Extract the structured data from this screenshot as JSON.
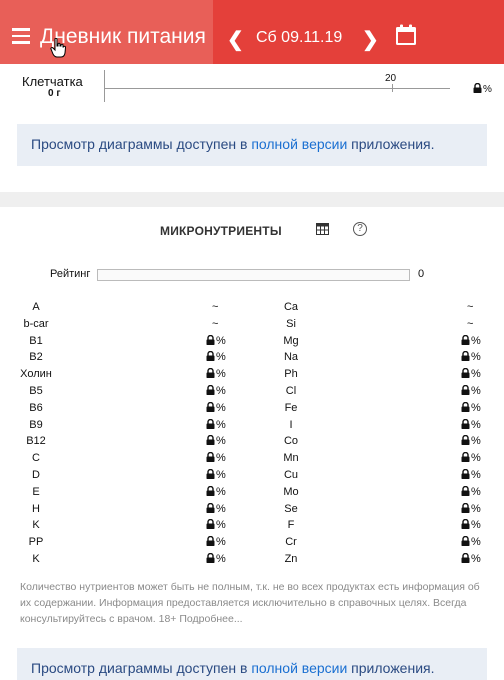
{
  "header": {
    "app_title": "Дневник питания",
    "prev_label": "❮",
    "date": "Сб 09.11.19",
    "next_label": "❯"
  },
  "fiber": {
    "label": "Клетчатка",
    "value": "0 г",
    "tick": "20",
    "pct": "%"
  },
  "notice": {
    "prefix": "Просмотр диаграммы доступен в ",
    "link": "полной версии",
    "suffix": " приложения."
  },
  "micro": {
    "title": "МИКРОНУТРИЕНТЫ",
    "help": "?",
    "rating_label": "Рейтинг",
    "rating_value": "0",
    "left": [
      {
        "name": "A",
        "value": "~"
      },
      {
        "name": "b-car",
        "value": "~"
      },
      {
        "name": "B1",
        "value": "%"
      },
      {
        "name": "B2",
        "value": "%"
      },
      {
        "name": "Холин",
        "value": "%"
      },
      {
        "name": "B5",
        "value": "%"
      },
      {
        "name": "B6",
        "value": "%"
      },
      {
        "name": "B9",
        "value": "%"
      },
      {
        "name": "B12",
        "value": "%"
      },
      {
        "name": "C",
        "value": "%"
      },
      {
        "name": "D",
        "value": "%"
      },
      {
        "name": "E",
        "value": "%"
      },
      {
        "name": "H",
        "value": "%"
      },
      {
        "name": "K",
        "value": "%"
      },
      {
        "name": "PP",
        "value": "%"
      },
      {
        "name": "K",
        "value": "%"
      }
    ],
    "right": [
      {
        "name": "Ca",
        "value": "~"
      },
      {
        "name": "Si",
        "value": "~"
      },
      {
        "name": "Mg",
        "value": "%"
      },
      {
        "name": "Na",
        "value": "%"
      },
      {
        "name": "Ph",
        "value": "%"
      },
      {
        "name": "Cl",
        "value": "%"
      },
      {
        "name": "Fe",
        "value": "%"
      },
      {
        "name": "I",
        "value": "%"
      },
      {
        "name": "Co",
        "value": "%"
      },
      {
        "name": "Mn",
        "value": "%"
      },
      {
        "name": "Cu",
        "value": "%"
      },
      {
        "name": "Mo",
        "value": "%"
      },
      {
        "name": "Se",
        "value": "%"
      },
      {
        "name": "F",
        "value": "%"
      },
      {
        "name": "Cr",
        "value": "%"
      },
      {
        "name": "Zn",
        "value": "%"
      }
    ],
    "disclaimer": "Количество нутриентов может быть не полным, т.к. не во всех продуктах есть информация об их содержании. Информация предоставляется исключительно в справочных целях. Всегда консультируйтесь с врачом. 18+ Подробнее..."
  },
  "colors": {
    "header_bg": "#e4403a",
    "header_title_bg": "#e85f58",
    "link": "#1a6fd1",
    "notice_bg": "#e9eef5"
  }
}
